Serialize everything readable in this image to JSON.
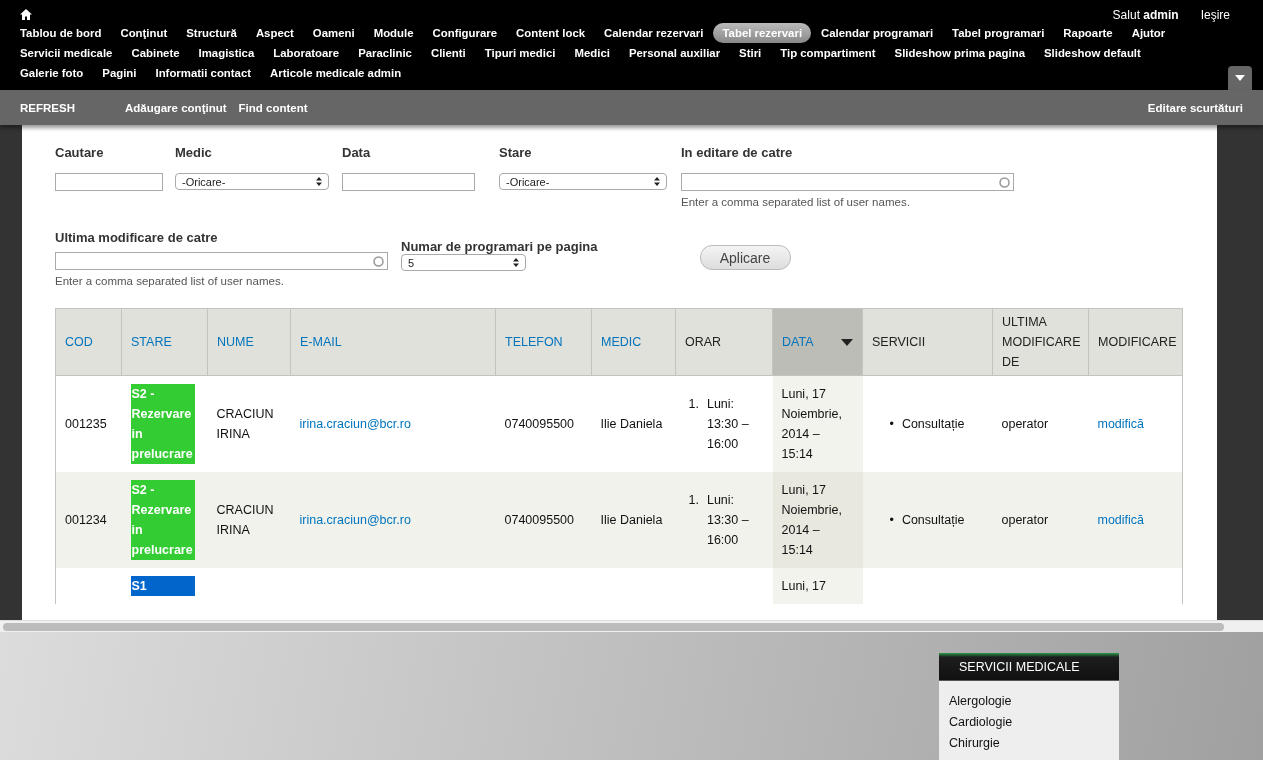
{
  "toolbar": {
    "greeting": "Salut",
    "user": "admin",
    "logout": "Ieşire",
    "menu": [
      {
        "label": "Tablou de bord",
        "selected": false
      },
      {
        "label": "Conţinut",
        "selected": false
      },
      {
        "label": "Structură",
        "selected": false
      },
      {
        "label": "Aspect",
        "selected": false
      },
      {
        "label": "Oameni",
        "selected": false
      },
      {
        "label": "Module",
        "selected": false
      },
      {
        "label": "Configurare",
        "selected": false
      },
      {
        "label": "Content lock",
        "selected": false
      },
      {
        "label": "Calendar rezervari",
        "selected": false
      },
      {
        "label": "Tabel rezervari",
        "selected": true
      },
      {
        "label": "Calendar programari",
        "selected": false
      },
      {
        "label": "Tabel programari",
        "selected": false
      },
      {
        "label": "Rapoarte",
        "selected": false
      },
      {
        "label": "Ajutor",
        "selected": false
      },
      {
        "label": "Servicii medicale",
        "selected": false
      },
      {
        "label": "Cabinete",
        "selected": false
      },
      {
        "label": "Imagistica",
        "selected": false
      },
      {
        "label": "Laboratoare",
        "selected": false
      },
      {
        "label": "Paraclinic",
        "selected": false
      },
      {
        "label": "Clienti",
        "selected": false
      },
      {
        "label": "Tipuri medici",
        "selected": false
      },
      {
        "label": "Medici",
        "selected": false
      },
      {
        "label": "Personal auxiliar",
        "selected": false
      },
      {
        "label": "Stiri",
        "selected": false
      },
      {
        "label": "Tip compartiment",
        "selected": false
      },
      {
        "label": "Slideshow prima pagina",
        "selected": false
      },
      {
        "label": "Slideshow default",
        "selected": false
      },
      {
        "label": "Galerie foto",
        "selected": false
      },
      {
        "label": "Pagini",
        "selected": false
      },
      {
        "label": "Informatii contact",
        "selected": false
      },
      {
        "label": "Articole medicale admin",
        "selected": false
      }
    ]
  },
  "shortcuts": {
    "items": [
      "REFRESH",
      "Adăugare conţinut",
      "Find content"
    ],
    "edit": "Editare scurtături"
  },
  "filters": {
    "cautare": {
      "label": "Cautare"
    },
    "medic": {
      "label": "Medic",
      "value": "-Oricare-"
    },
    "data": {
      "label": "Data"
    },
    "stare": {
      "label": "Stare",
      "value": "-Oricare-"
    },
    "editing_by": {
      "label": "In editare de catre",
      "hint": "Enter a comma separated list of user names."
    },
    "modified_by": {
      "label": "Ultima modificare de catre",
      "hint": "Enter a comma separated list of user names."
    },
    "per_page": {
      "label": "Numar de programari pe pagina",
      "value": "5"
    },
    "apply": "Aplicare"
  },
  "table": {
    "columns": [
      {
        "label": "COD",
        "sortable": true,
        "sorted": false
      },
      {
        "label": "STARE",
        "sortable": true,
        "sorted": false
      },
      {
        "label": "NUME",
        "sortable": true,
        "sorted": false
      },
      {
        "label": "E-MAIL",
        "sortable": true,
        "sorted": false
      },
      {
        "label": "TELEFON",
        "sortable": true,
        "sorted": false
      },
      {
        "label": "MEDIC",
        "sortable": true,
        "sorted": false
      },
      {
        "label": "ORAR",
        "sortable": false,
        "sorted": false
      },
      {
        "label": "DATA",
        "sortable": true,
        "sorted": true
      },
      {
        "label": "SERVICII",
        "sortable": false,
        "sorted": false
      },
      {
        "label": "ULTIMA MODIFICARE DE",
        "sortable": false,
        "sorted": false
      },
      {
        "label": "MODIFICARE",
        "sortable": false,
        "sorted": false
      }
    ],
    "rows": [
      {
        "cod": "001235",
        "stare": {
          "text": "S2 - Rezervare in prelucrare",
          "color": "#33cc33"
        },
        "nume": "CRACIUN IRINA",
        "email": "irina.craciun@bcr.ro",
        "telefon": "0740095500",
        "medic": "Ilie Daniela",
        "orar": {
          "number": "1.",
          "text": "Luni: 13:30 – 16:00"
        },
        "data": "Luni, 17 Noiembrie, 2014 – 15:14",
        "servicii": {
          "bullet": "•",
          "text": "Consultație"
        },
        "modificat_de": "operator",
        "action": "modifică"
      },
      {
        "cod": "001234",
        "stare": {
          "text": "S2 - Rezervare in prelucrare",
          "color": "#33cc33"
        },
        "nume": "CRACIUN IRINA",
        "email": "irina.craciun@bcr.ro",
        "telefon": "0740095500",
        "medic": "Ilie Daniela",
        "orar": {
          "number": "1.",
          "text": "Luni: 13:30 – 16:00"
        },
        "data": "Luni, 17 Noiembrie, 2014 – 15:14",
        "servicii": {
          "bullet": "•",
          "text": "Consultație"
        },
        "modificat_de": "operator",
        "action": "modifică"
      },
      {
        "stare": {
          "text": "S1",
          "color": "#0066cc"
        },
        "data": "Luni, 17"
      }
    ]
  },
  "sidebar": {
    "title": "SERVICII MEDICALE",
    "items": [
      "Alergologie",
      "Cardiologie",
      "Chirurgie"
    ]
  }
}
